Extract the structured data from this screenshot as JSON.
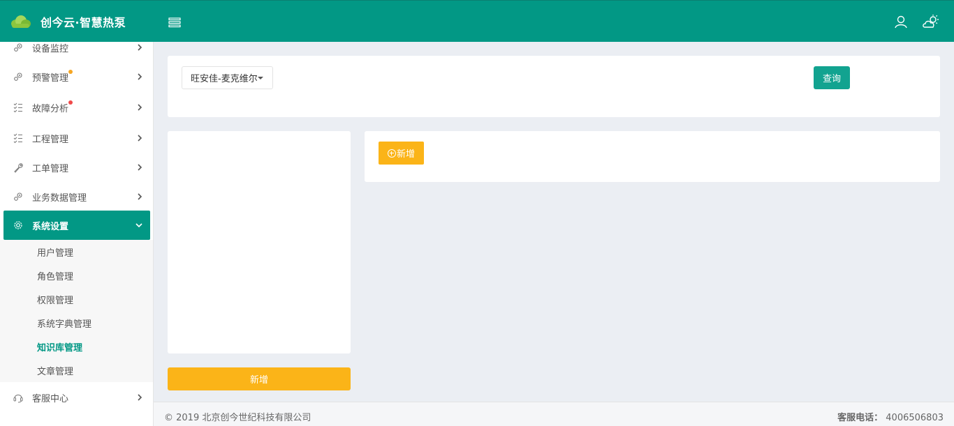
{
  "header": {
    "brand_title": "创今云·智慧热泵",
    "accent_color": "#029885"
  },
  "sidebar": {
    "items": [
      {
        "label": "设备监控",
        "icon": "gears-icon"
      },
      {
        "label": "预警管理",
        "icon": "gears-icon",
        "badge_color": "#f6a623"
      },
      {
        "label": "故障分析",
        "icon": "checklist-icon",
        "badge_color": "#f04a4a"
      },
      {
        "label": "工程管理",
        "icon": "checklist-icon"
      },
      {
        "label": "工单管理",
        "icon": "wrench-icon"
      },
      {
        "label": "业务数据管理",
        "icon": "gears-icon"
      },
      {
        "label": "系统设置",
        "icon": "settings-icon"
      },
      {
        "label": "客服中心",
        "icon": "headset-icon"
      }
    ],
    "submenu": [
      "用户管理",
      "角色管理",
      "权限管理",
      "系统字典管理",
      "知识库管理",
      "文章管理"
    ]
  },
  "filter": {
    "selected": "旺安佳-麦克维尔",
    "query_label": "查询"
  },
  "content": {
    "add_label": "新增"
  },
  "tree": {
    "add_label": "新增"
  },
  "footer": {
    "copyright": "© 2019 北京创今世纪科技有限公司",
    "service_label": "客服电话：",
    "service_phone": "4006506803"
  }
}
